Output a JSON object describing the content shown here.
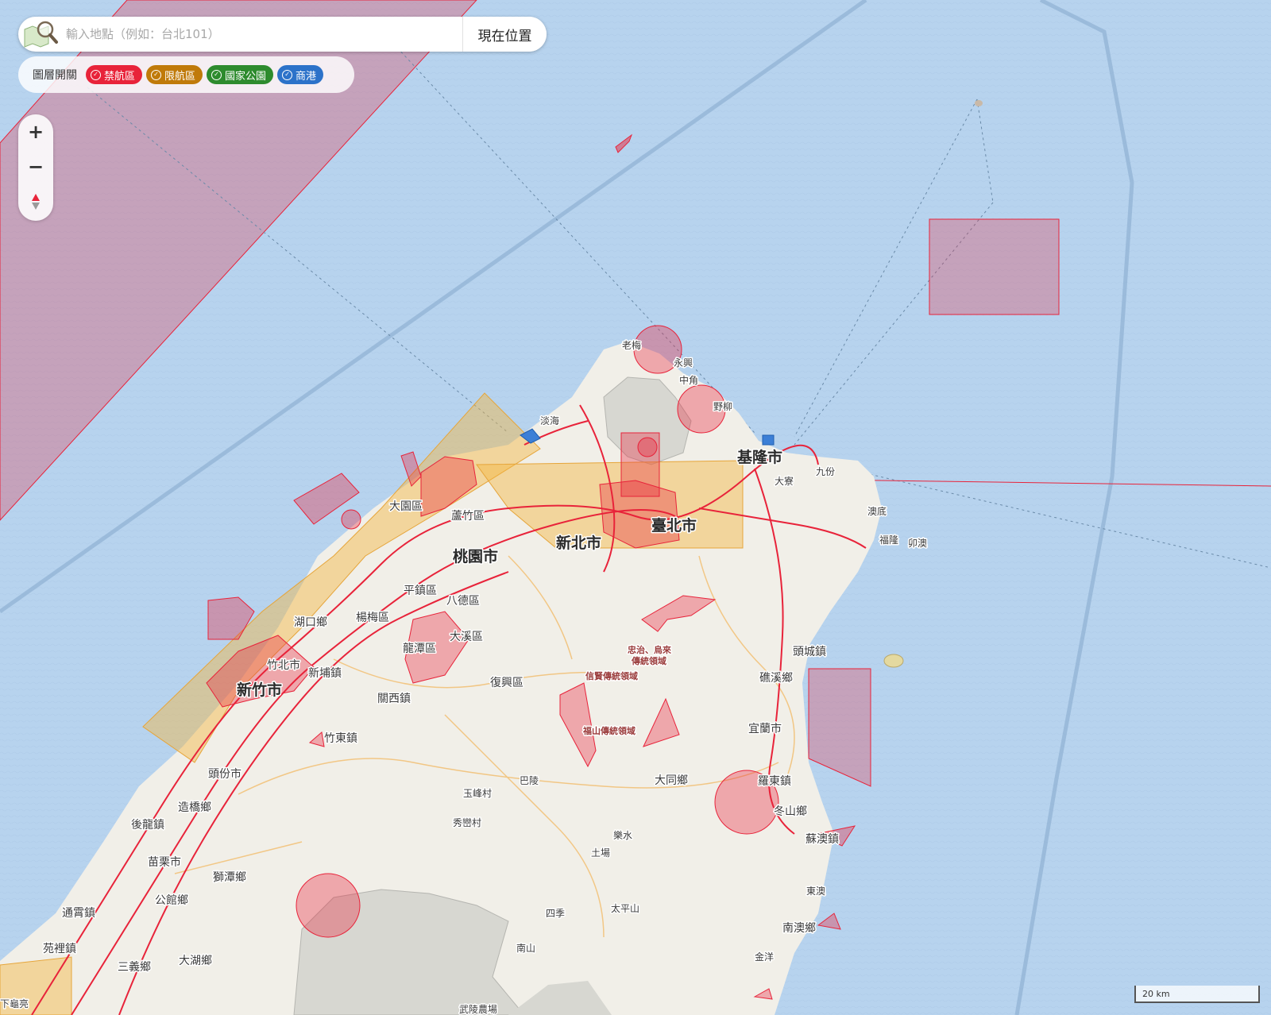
{
  "search": {
    "placeholder": "輸入地點（例如：台北101）",
    "value": "",
    "locate_label": "現在位置"
  },
  "layers": {
    "title": "圖層開關",
    "items": [
      {
        "label": "禁航區",
        "color": "#e8233a",
        "checked": true
      },
      {
        "label": "限航區",
        "color": "#c07a0a",
        "checked": true
      },
      {
        "label": "國家公園",
        "color": "#2e8b2e",
        "checked": true
      },
      {
        "label": "商港",
        "color": "#2c72c9",
        "checked": true
      }
    ]
  },
  "zoom": {
    "in_label": "+",
    "out_label": "−",
    "compass_icon": "compass-icon"
  },
  "scale": {
    "label": "20 km"
  },
  "colors": {
    "sea": "#b7d3ee",
    "land": "#f1efe8",
    "mountain": "#d7d7d1",
    "no_fly": "#e8233a",
    "restricted": "#f5b640",
    "road": "#f2c27a"
  },
  "places": {
    "cities": [
      "基隆市",
      "臺北市",
      "新北市",
      "桃園市",
      "新竹市",
      "宜蘭市"
    ],
    "towns": [
      "老梅",
      "永興",
      "中角",
      "野柳",
      "淡海",
      "九份",
      "大寮",
      "澳底",
      "福隆",
      "卯澳",
      "大園區",
      "蘆竹區",
      "平鎮區",
      "八德區",
      "楊梅區",
      "湖口鄉",
      "大溪區",
      "龍潭區",
      "竹北市",
      "新埔鎮",
      "關西鎮",
      "復興區",
      "竹東鎮",
      "頭份市",
      "造橋鄉",
      "後龍鎮",
      "苗栗市",
      "獅潭鄉",
      "公館鄉",
      "通霄鎮",
      "苑裡鎮",
      "三義鄉",
      "大湖鄉",
      "下龜亮",
      "玉峰村",
      "巴陵",
      "秀巒村",
      "樂水",
      "土場",
      "大同鄉",
      "羅東鎮",
      "冬山鄉",
      "蘇澳鎮",
      "礁溪鄉",
      "頭城鎮",
      "東澳",
      "南澳鄉",
      "金洋",
      "四季",
      "太平山",
      "南山",
      "武陵農場"
    ],
    "zones": [
      "忠治、烏來",
      "傳統領域",
      "信賢傳統領域",
      "福山傳統領域"
    ]
  }
}
